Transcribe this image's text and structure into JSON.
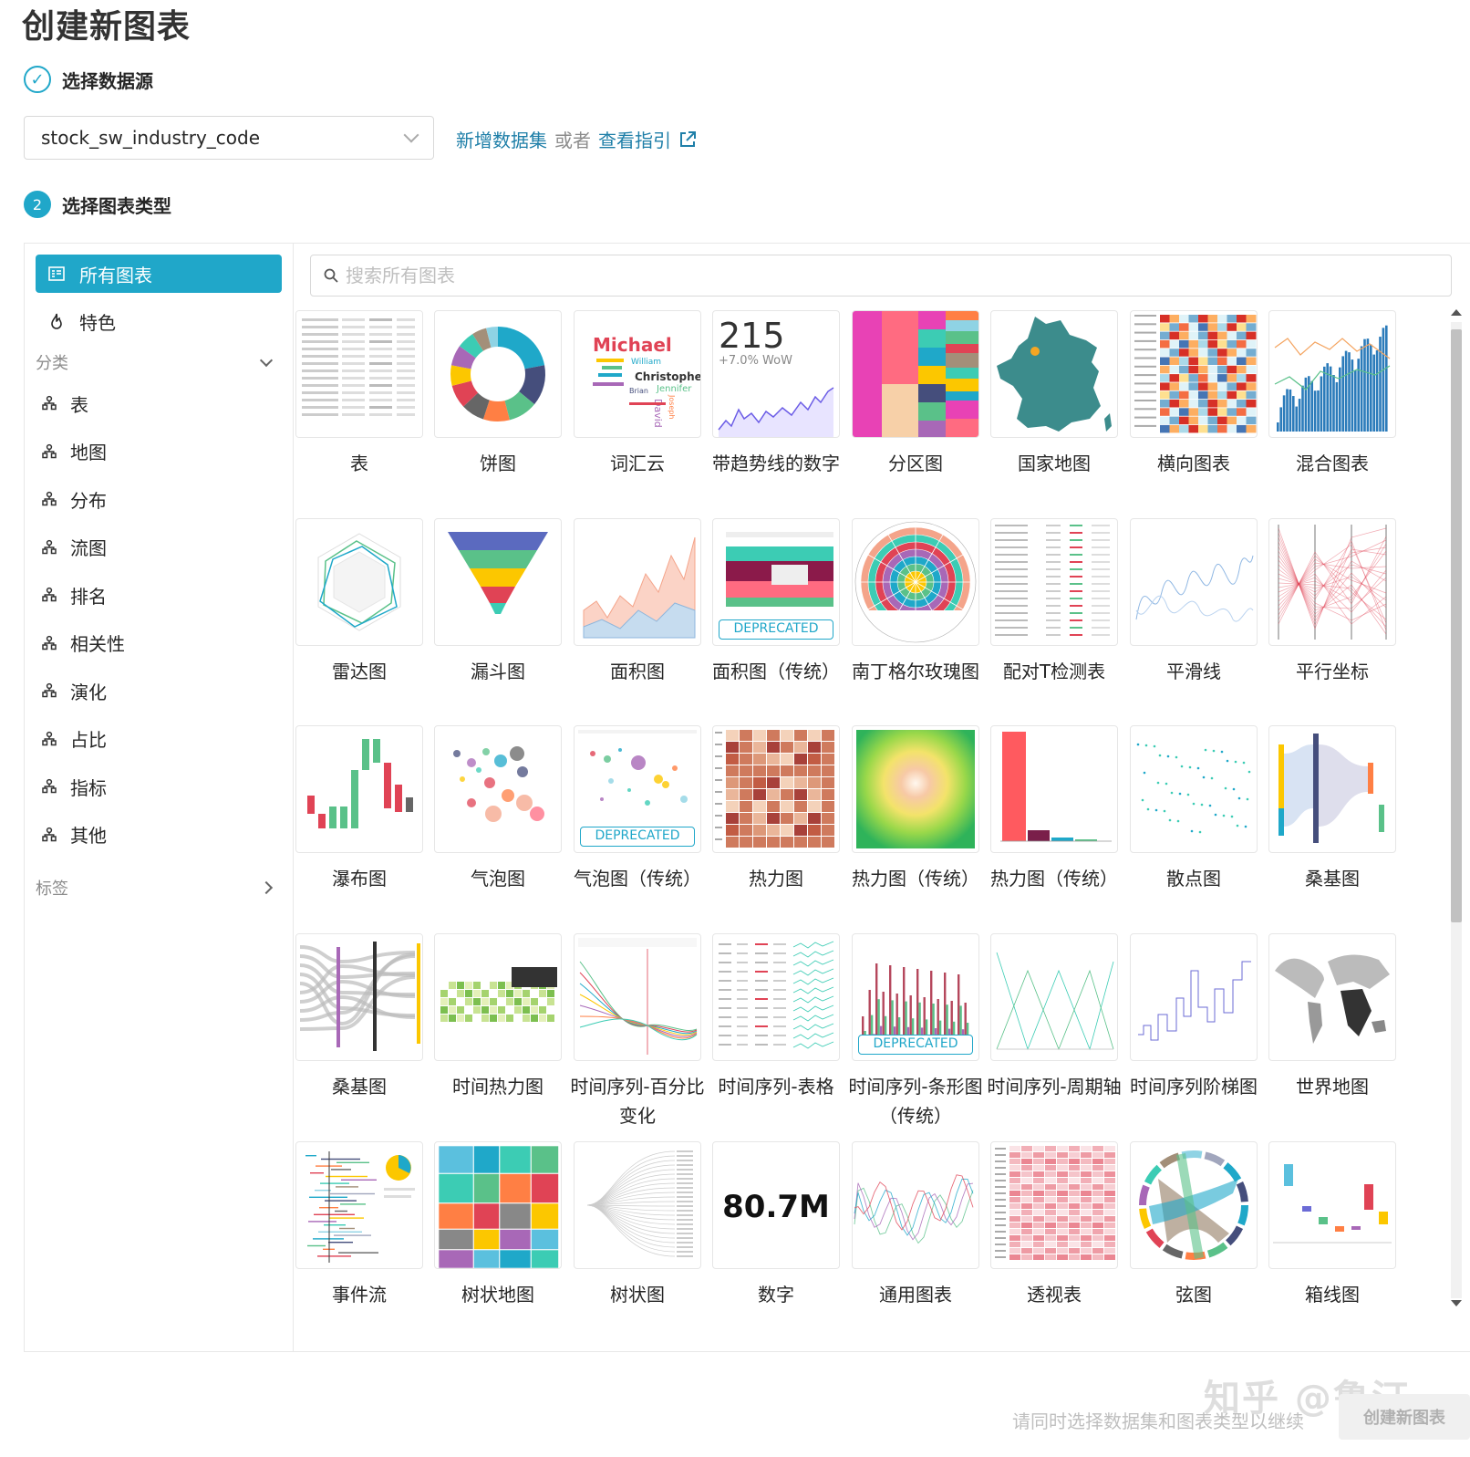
{
  "page": {
    "title": "创建新图表"
  },
  "steps": {
    "step1": {
      "number": "✓",
      "label": "选择数据源"
    },
    "step2": {
      "number": "2",
      "label": "选择图表类型"
    }
  },
  "datasource": {
    "selected": "stock_sw_industry_code",
    "add_link": "新增数据集",
    "or": "或者",
    "guide_link": "查看指引"
  },
  "sidebar": {
    "all_charts": "所有图表",
    "featured": "特色",
    "category_header": "分类",
    "categories": [
      "表",
      "地图",
      "分布",
      "流图",
      "排名",
      "相关性",
      "演化",
      "占比",
      "指标",
      "其他"
    ],
    "tags_header": "标签"
  },
  "search": {
    "placeholder": "搜索所有图表"
  },
  "thumb_text": {
    "big_number_value": "215",
    "big_number_delta": "+7.0% WoW",
    "number_value": "80.7M",
    "deprecated": "DEPRECATED",
    "wordcloud_words": [
      "Michael",
      "Christopher",
      "Jennifer",
      "William",
      "David",
      "Joseph",
      "Brian"
    ]
  },
  "charts": [
    "表",
    "饼图",
    "词汇云",
    "带趋势线的数字",
    "分区图",
    "国家地图",
    "横向图表",
    "混合图表",
    "雷达图",
    "漏斗图",
    "面积图",
    "面积图（传统）",
    "南丁格尔玫瑰图",
    "配对T检测表",
    "平滑线",
    "平行坐标",
    "瀑布图",
    "气泡图",
    "气泡图（传统）",
    "热力图",
    "热力图（传统）",
    "热力图（传统）",
    "散点图",
    "桑基图",
    "桑基图",
    "时间热力图",
    "时间序列-百分比变化",
    "时间序列-表格",
    "时间序列-条形图（传统）",
    "时间序列-周期轴",
    "时间序列阶梯图",
    "世界地图",
    "事件流",
    "树状地图",
    "树状图",
    "数字",
    "通用图表",
    "透视表",
    "弦图",
    "箱线图"
  ],
  "footer": {
    "hint": "请同时选择数据集和图表类型以继续",
    "create_button": "创建新图表",
    "watermark": "知乎 @鲁汀"
  },
  "colors": {
    "accent": "#20a7c9",
    "link": "#1f7fa8"
  }
}
